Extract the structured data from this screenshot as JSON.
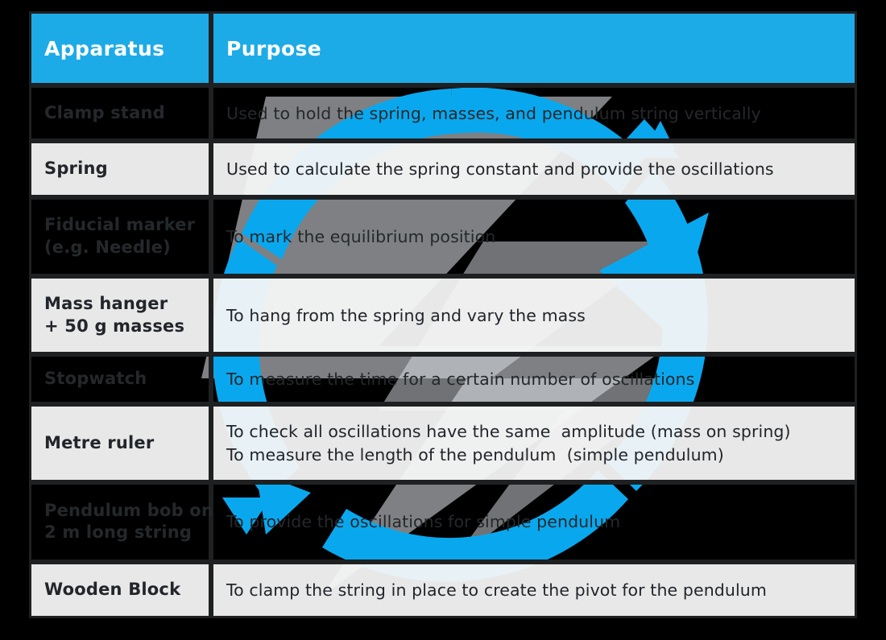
{
  "colors": {
    "header_blue": "#1dabe8",
    "watermark_blue": "#09a8ee",
    "watermark_grey": "#e9ecef",
    "page_background": "#000000",
    "light_row": "#f6f6f6",
    "border": "#1f2022",
    "header_text": "#ffffff",
    "dark_row_text": "#25282b",
    "light_row_text": "#22252a"
  },
  "watermark": {
    "name": "circular-arrow-logo",
    "description": "Large translucent circular recycle/refresh arrow logo behind the table"
  },
  "table": {
    "name": "apparatus-purpose-table",
    "columns": [
      {
        "key": "apparatus",
        "label": "Apparatus"
      },
      {
        "key": "purpose",
        "label": "Purpose"
      }
    ],
    "rows": [
      {
        "shade": "dark",
        "apparatus": [
          "Clamp stand"
        ],
        "purpose": [
          "Used to hold the spring, masses, and pendulum string vertically"
        ]
      },
      {
        "shade": "light",
        "apparatus": [
          "Spring"
        ],
        "purpose": [
          "Used to calculate the spring constant and provide the oscillations"
        ]
      },
      {
        "shade": "dark",
        "apparatus": [
          "Fiducial marker",
          "(e.g. Needle)"
        ],
        "purpose": [
          "To mark the equilibrium position"
        ]
      },
      {
        "shade": "light",
        "apparatus": [
          "Mass hanger",
          "+ 50 g masses"
        ],
        "purpose": [
          "To hang from the spring and vary the mass"
        ]
      },
      {
        "shade": "dark",
        "apparatus": [
          "Stopwatch"
        ],
        "purpose": [
          "To measure the time for a certain number of oscillations"
        ]
      },
      {
        "shade": "light",
        "apparatus": [
          "Metre ruler"
        ],
        "purpose": [
          "To check all oscillations have the same  amplitude (mass on spring)",
          "To measure the length of the pendulum  (simple pendulum)"
        ]
      },
      {
        "shade": "dark",
        "apparatus": [
          "Pendulum bob on",
          "2 m long string"
        ],
        "purpose": [
          "To provide the oscillations for simple pendulum"
        ]
      },
      {
        "shade": "light",
        "apparatus": [
          "Wooden Block"
        ],
        "purpose": [
          "To clamp the string in place to create the pivot for the pendulum"
        ]
      }
    ]
  }
}
